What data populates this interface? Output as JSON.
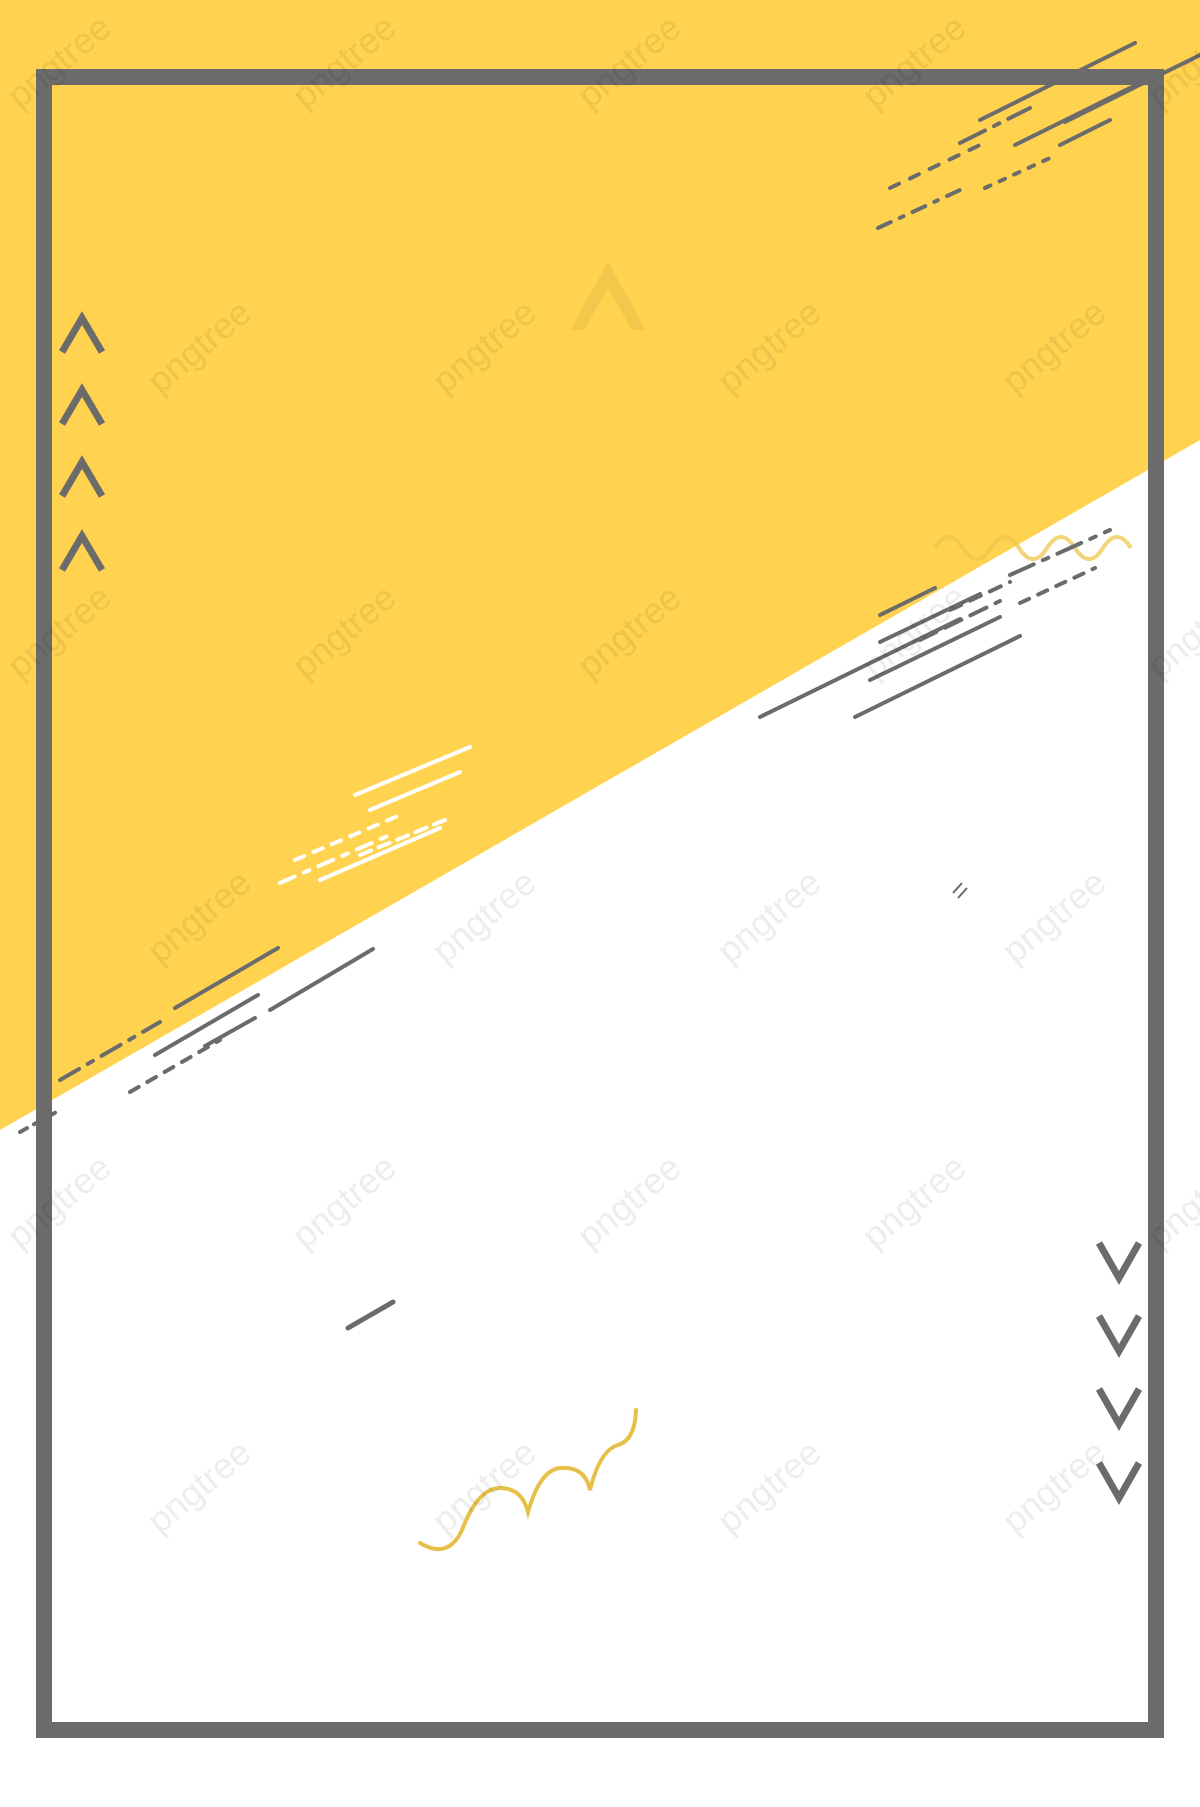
{
  "palette": {
    "accent": "#FFD24F",
    "ink": "#6B6B6B",
    "paper": "#FFFFFF",
    "squiggle": "#E6C14A"
  },
  "icons": {
    "chevron_up": "chevron-up-icon",
    "chevron_down": "chevron-down-icon",
    "squiggle": "squiggle-line-icon"
  },
  "watermark": {
    "text": "pngtree"
  }
}
